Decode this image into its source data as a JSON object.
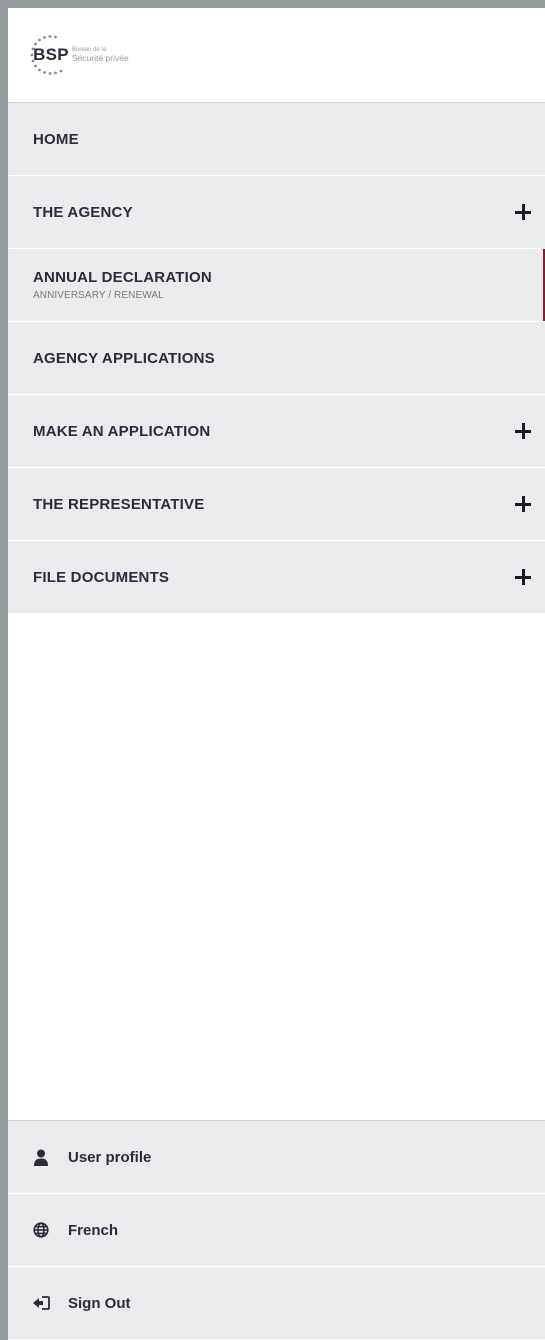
{
  "brand": {
    "abbr": "BSP",
    "line1": "Bureau de la",
    "line2": "Sécurité privée"
  },
  "nav": [
    {
      "label": "HOME",
      "sub": "",
      "expandable": false
    },
    {
      "label": "THE AGENCY",
      "sub": "",
      "expandable": true
    },
    {
      "label": "ANNUAL DECLARATION",
      "sub": "ANNIVERSARY / RENEWAL",
      "expandable": false,
      "active": true
    },
    {
      "label": "AGENCY APPLICATIONS",
      "sub": "",
      "expandable": false
    },
    {
      "label": "MAKE AN APPLICATION",
      "sub": "",
      "expandable": true
    },
    {
      "label": "THE REPRESENTATIVE",
      "sub": "",
      "expandable": true
    },
    {
      "label": "FILE DOCUMENTS",
      "sub": "",
      "expandable": true
    }
  ],
  "footer": {
    "profile": "User profile",
    "language": "French",
    "signout": "Sign Out"
  },
  "colors": {
    "active_marker": "#7b1d34",
    "item_bg": "#eaebec",
    "frame": "#939a9c"
  }
}
